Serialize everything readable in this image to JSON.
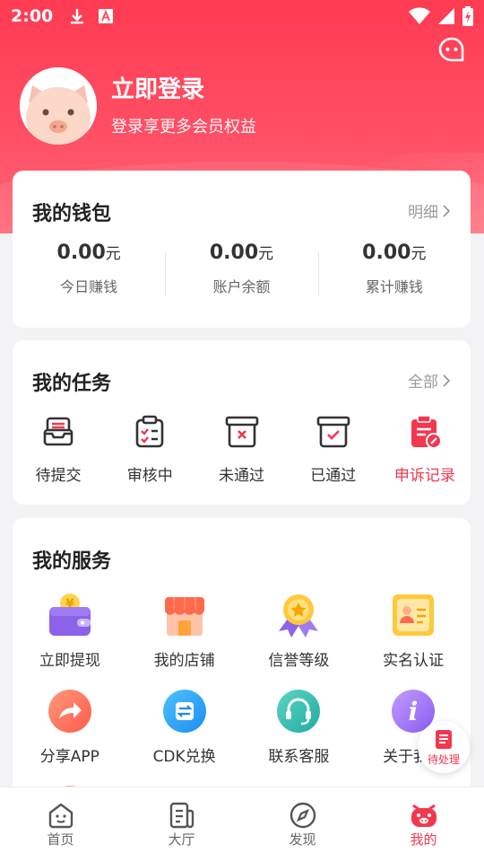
{
  "status_bar": {
    "time": "2:00"
  },
  "colors": {
    "brand": "#ff3b52",
    "accent_red": "#f2384f"
  },
  "profile": {
    "name": "立即登录",
    "subtitle": "登录享更多会员权益"
  },
  "wallet": {
    "title": "我的钱包",
    "link": "明细",
    "stats": [
      {
        "value": "0.00",
        "unit": "元",
        "label": "今日赚钱"
      },
      {
        "value": "0.00",
        "unit": "元",
        "label": "账户余额"
      },
      {
        "value": "0.00",
        "unit": "元",
        "label": "累计赚钱"
      }
    ]
  },
  "tasks": {
    "title": "我的任务",
    "link": "全部",
    "items": [
      {
        "label": "待提交",
        "icon": "inbox-icon"
      },
      {
        "label": "审核中",
        "icon": "clipboard-check-icon"
      },
      {
        "label": "未通过",
        "icon": "box-x-icon"
      },
      {
        "label": "已通过",
        "icon": "box-check-icon"
      },
      {
        "label": "申诉记录",
        "icon": "appeal-record-icon"
      }
    ]
  },
  "services": {
    "title": "我的服务",
    "items": [
      {
        "label": "立即提现",
        "icon": "wallet-icon"
      },
      {
        "label": "我的店铺",
        "icon": "store-icon"
      },
      {
        "label": "信誉等级",
        "icon": "medal-icon"
      },
      {
        "label": "实名认证",
        "icon": "id-card-icon"
      },
      {
        "label": "分享APP",
        "icon": "share-icon"
      },
      {
        "label": "CDK兑换",
        "icon": "exchange-icon"
      },
      {
        "label": "联系客服",
        "icon": "headset-icon"
      },
      {
        "label": "关于我们",
        "icon": "info-icon"
      }
    ]
  },
  "float_button": {
    "label": "待处理"
  },
  "tabbar": {
    "tabs": [
      {
        "label": "首页",
        "icon": "home-face-icon"
      },
      {
        "label": "大厅",
        "icon": "document-icon"
      },
      {
        "label": "发现",
        "icon": "compass-icon"
      },
      {
        "label": "我的",
        "icon": "pig-icon"
      }
    ]
  }
}
